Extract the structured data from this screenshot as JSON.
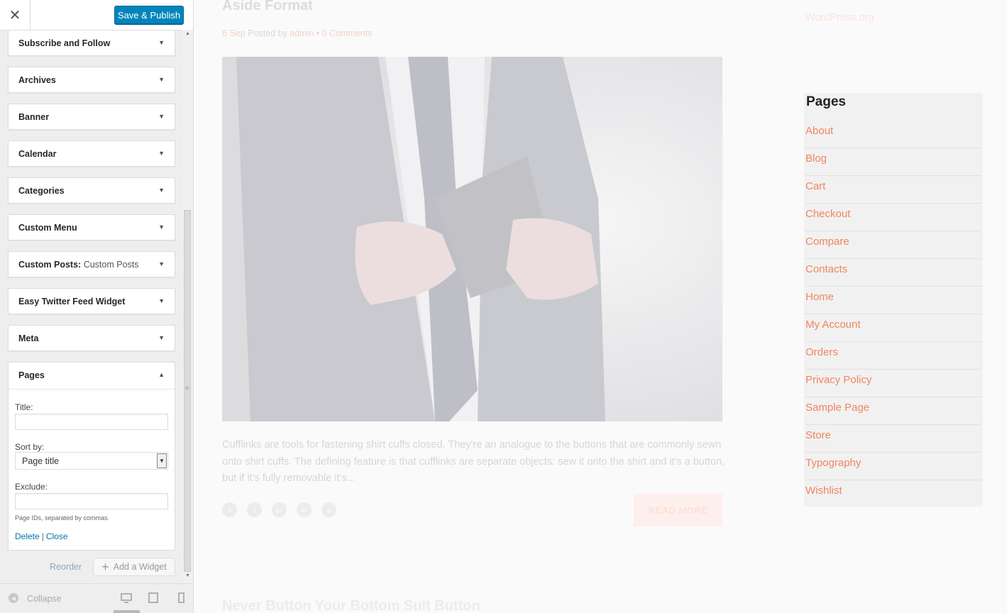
{
  "header": {
    "close_icon": "close-icon",
    "publish_label": "Save & Publish"
  },
  "widgets": [
    {
      "title": "Subscribe and Follow",
      "sub": ""
    },
    {
      "title": "Archives",
      "sub": ""
    },
    {
      "title": "Banner",
      "sub": ""
    },
    {
      "title": "Calendar",
      "sub": ""
    },
    {
      "title": "Categories",
      "sub": ""
    },
    {
      "title": "Custom Menu",
      "sub": ""
    },
    {
      "title": "Custom Posts:",
      "sub": "Custom Posts"
    },
    {
      "title": "Easy Twitter Feed Widget",
      "sub": ""
    },
    {
      "title": "Meta",
      "sub": ""
    }
  ],
  "pages_widget": {
    "title": "Pages",
    "title_label": "Title:",
    "title_value": "",
    "sort_label": "Sort by:",
    "sort_value": "Page title",
    "exclude_label": "Exclude:",
    "exclude_value": "",
    "hint": "Page IDs, separated by commas.",
    "delete_label": "Delete",
    "separator": "|",
    "close_label": "Close"
  },
  "actions": {
    "reorder_label": "Reorder",
    "add_widget_label": "Add a Widget"
  },
  "footer": {
    "collapse_label": "Collapse",
    "devices": [
      "desktop-icon",
      "tablet-icon",
      "mobile-icon"
    ]
  },
  "preview": {
    "post_title": "Aside Format",
    "post_date": "6 Sep",
    "posted_by": "Posted by",
    "author": "admin",
    "bullet": "•",
    "comments": "0 Comments",
    "excerpt": "Cufflinks are tools for fastening shirt cuffs closed. They're an analogue to the buttons that are commonly sewn onto shirt cuffs. The defining feature is that cufflinks are separate objects: sew it onto the shirt and it's a button, but if it's fully removable it's...",
    "read_more": "READ MORE",
    "social_icons": [
      "facebook-icon",
      "twitter-icon",
      "google-plus-icon",
      "linkedin-icon",
      "pinterest-icon"
    ],
    "next_title": "Never Button Your Bottom Suit Button",
    "wp_org": "WordPress.org",
    "pages_heading": "Pages",
    "pages": [
      "About",
      "Blog",
      "Cart",
      "Checkout",
      "Compare",
      "Contacts",
      "Home",
      "My Account",
      "Orders",
      "Privacy Policy",
      "Sample Page",
      "Store",
      "Typography",
      "Wishlist"
    ]
  },
  "colors": {
    "publish": "#0085ba",
    "link": "#0073aa",
    "accent": "#f0865f"
  }
}
